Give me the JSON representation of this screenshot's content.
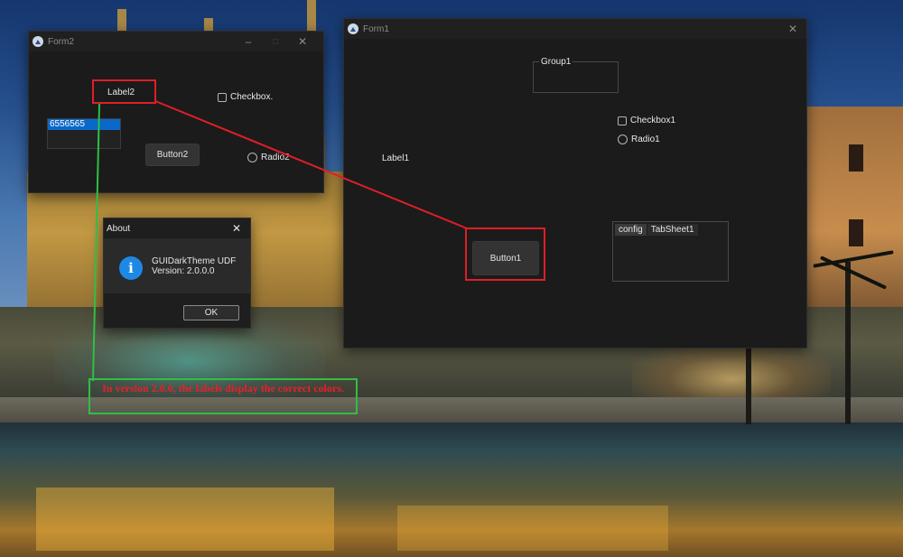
{
  "form2": {
    "title": "Form2",
    "label": "Label2",
    "checkbox": "Checkbox.",
    "listbox_selected": "6556565",
    "button": "Button2",
    "radio": "Radio2"
  },
  "form1": {
    "title": "Form1",
    "group_title": "Group1",
    "checkbox": "Checkbox1",
    "radio": "Radio1",
    "label": "Label1",
    "button": "Button1",
    "tabs": [
      "config",
      "TabSheet1"
    ]
  },
  "about": {
    "title": "About",
    "app_name": "GUIDarkTheme UDF",
    "version": "Version:  2.0.0.0",
    "ok": "OK",
    "info_icon_glyph": "i"
  },
  "annotation": {
    "text": "In version 2.0.0, the labels display the correct colors.",
    "red_color": "#e01e26",
    "green_color": "#2fbf46"
  },
  "colors": {
    "window_bg": "#1b1b1b",
    "accent_blue": "#0a68c8"
  }
}
